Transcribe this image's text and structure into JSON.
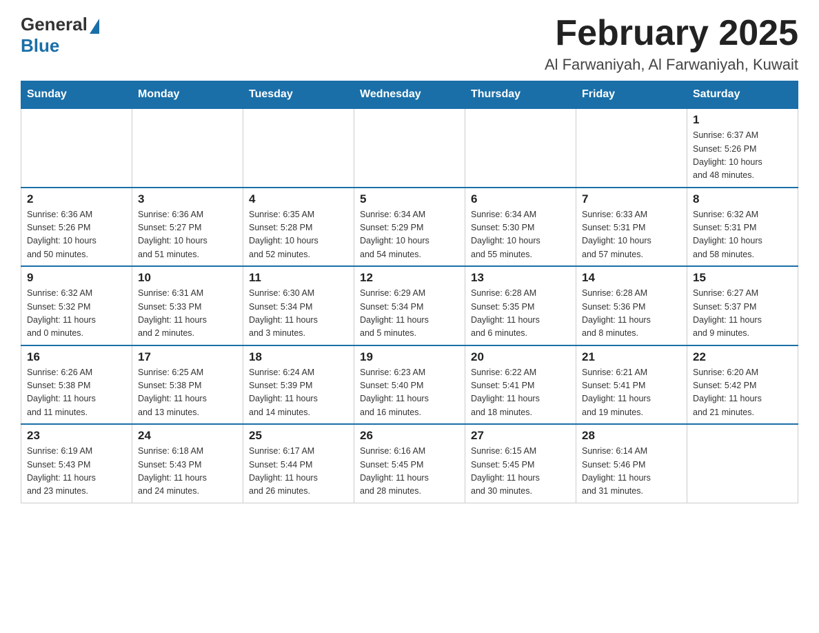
{
  "logo": {
    "general": "General",
    "blue": "Blue"
  },
  "header": {
    "month": "February 2025",
    "location": "Al Farwaniyah, Al Farwaniyah, Kuwait"
  },
  "weekdays": [
    "Sunday",
    "Monday",
    "Tuesday",
    "Wednesday",
    "Thursday",
    "Friday",
    "Saturday"
  ],
  "weeks": [
    [
      {
        "day": "",
        "info": ""
      },
      {
        "day": "",
        "info": ""
      },
      {
        "day": "",
        "info": ""
      },
      {
        "day": "",
        "info": ""
      },
      {
        "day": "",
        "info": ""
      },
      {
        "day": "",
        "info": ""
      },
      {
        "day": "1",
        "info": "Sunrise: 6:37 AM\nSunset: 5:26 PM\nDaylight: 10 hours\nand 48 minutes."
      }
    ],
    [
      {
        "day": "2",
        "info": "Sunrise: 6:36 AM\nSunset: 5:26 PM\nDaylight: 10 hours\nand 50 minutes."
      },
      {
        "day": "3",
        "info": "Sunrise: 6:36 AM\nSunset: 5:27 PM\nDaylight: 10 hours\nand 51 minutes."
      },
      {
        "day": "4",
        "info": "Sunrise: 6:35 AM\nSunset: 5:28 PM\nDaylight: 10 hours\nand 52 minutes."
      },
      {
        "day": "5",
        "info": "Sunrise: 6:34 AM\nSunset: 5:29 PM\nDaylight: 10 hours\nand 54 minutes."
      },
      {
        "day": "6",
        "info": "Sunrise: 6:34 AM\nSunset: 5:30 PM\nDaylight: 10 hours\nand 55 minutes."
      },
      {
        "day": "7",
        "info": "Sunrise: 6:33 AM\nSunset: 5:31 PM\nDaylight: 10 hours\nand 57 minutes."
      },
      {
        "day": "8",
        "info": "Sunrise: 6:32 AM\nSunset: 5:31 PM\nDaylight: 10 hours\nand 58 minutes."
      }
    ],
    [
      {
        "day": "9",
        "info": "Sunrise: 6:32 AM\nSunset: 5:32 PM\nDaylight: 11 hours\nand 0 minutes."
      },
      {
        "day": "10",
        "info": "Sunrise: 6:31 AM\nSunset: 5:33 PM\nDaylight: 11 hours\nand 2 minutes."
      },
      {
        "day": "11",
        "info": "Sunrise: 6:30 AM\nSunset: 5:34 PM\nDaylight: 11 hours\nand 3 minutes."
      },
      {
        "day": "12",
        "info": "Sunrise: 6:29 AM\nSunset: 5:34 PM\nDaylight: 11 hours\nand 5 minutes."
      },
      {
        "day": "13",
        "info": "Sunrise: 6:28 AM\nSunset: 5:35 PM\nDaylight: 11 hours\nand 6 minutes."
      },
      {
        "day": "14",
        "info": "Sunrise: 6:28 AM\nSunset: 5:36 PM\nDaylight: 11 hours\nand 8 minutes."
      },
      {
        "day": "15",
        "info": "Sunrise: 6:27 AM\nSunset: 5:37 PM\nDaylight: 11 hours\nand 9 minutes."
      }
    ],
    [
      {
        "day": "16",
        "info": "Sunrise: 6:26 AM\nSunset: 5:38 PM\nDaylight: 11 hours\nand 11 minutes."
      },
      {
        "day": "17",
        "info": "Sunrise: 6:25 AM\nSunset: 5:38 PM\nDaylight: 11 hours\nand 13 minutes."
      },
      {
        "day": "18",
        "info": "Sunrise: 6:24 AM\nSunset: 5:39 PM\nDaylight: 11 hours\nand 14 minutes."
      },
      {
        "day": "19",
        "info": "Sunrise: 6:23 AM\nSunset: 5:40 PM\nDaylight: 11 hours\nand 16 minutes."
      },
      {
        "day": "20",
        "info": "Sunrise: 6:22 AM\nSunset: 5:41 PM\nDaylight: 11 hours\nand 18 minutes."
      },
      {
        "day": "21",
        "info": "Sunrise: 6:21 AM\nSunset: 5:41 PM\nDaylight: 11 hours\nand 19 minutes."
      },
      {
        "day": "22",
        "info": "Sunrise: 6:20 AM\nSunset: 5:42 PM\nDaylight: 11 hours\nand 21 minutes."
      }
    ],
    [
      {
        "day": "23",
        "info": "Sunrise: 6:19 AM\nSunset: 5:43 PM\nDaylight: 11 hours\nand 23 minutes."
      },
      {
        "day": "24",
        "info": "Sunrise: 6:18 AM\nSunset: 5:43 PM\nDaylight: 11 hours\nand 24 minutes."
      },
      {
        "day": "25",
        "info": "Sunrise: 6:17 AM\nSunset: 5:44 PM\nDaylight: 11 hours\nand 26 minutes."
      },
      {
        "day": "26",
        "info": "Sunrise: 6:16 AM\nSunset: 5:45 PM\nDaylight: 11 hours\nand 28 minutes."
      },
      {
        "day": "27",
        "info": "Sunrise: 6:15 AM\nSunset: 5:45 PM\nDaylight: 11 hours\nand 30 minutes."
      },
      {
        "day": "28",
        "info": "Sunrise: 6:14 AM\nSunset: 5:46 PM\nDaylight: 11 hours\nand 31 minutes."
      },
      {
        "day": "",
        "info": ""
      }
    ]
  ]
}
